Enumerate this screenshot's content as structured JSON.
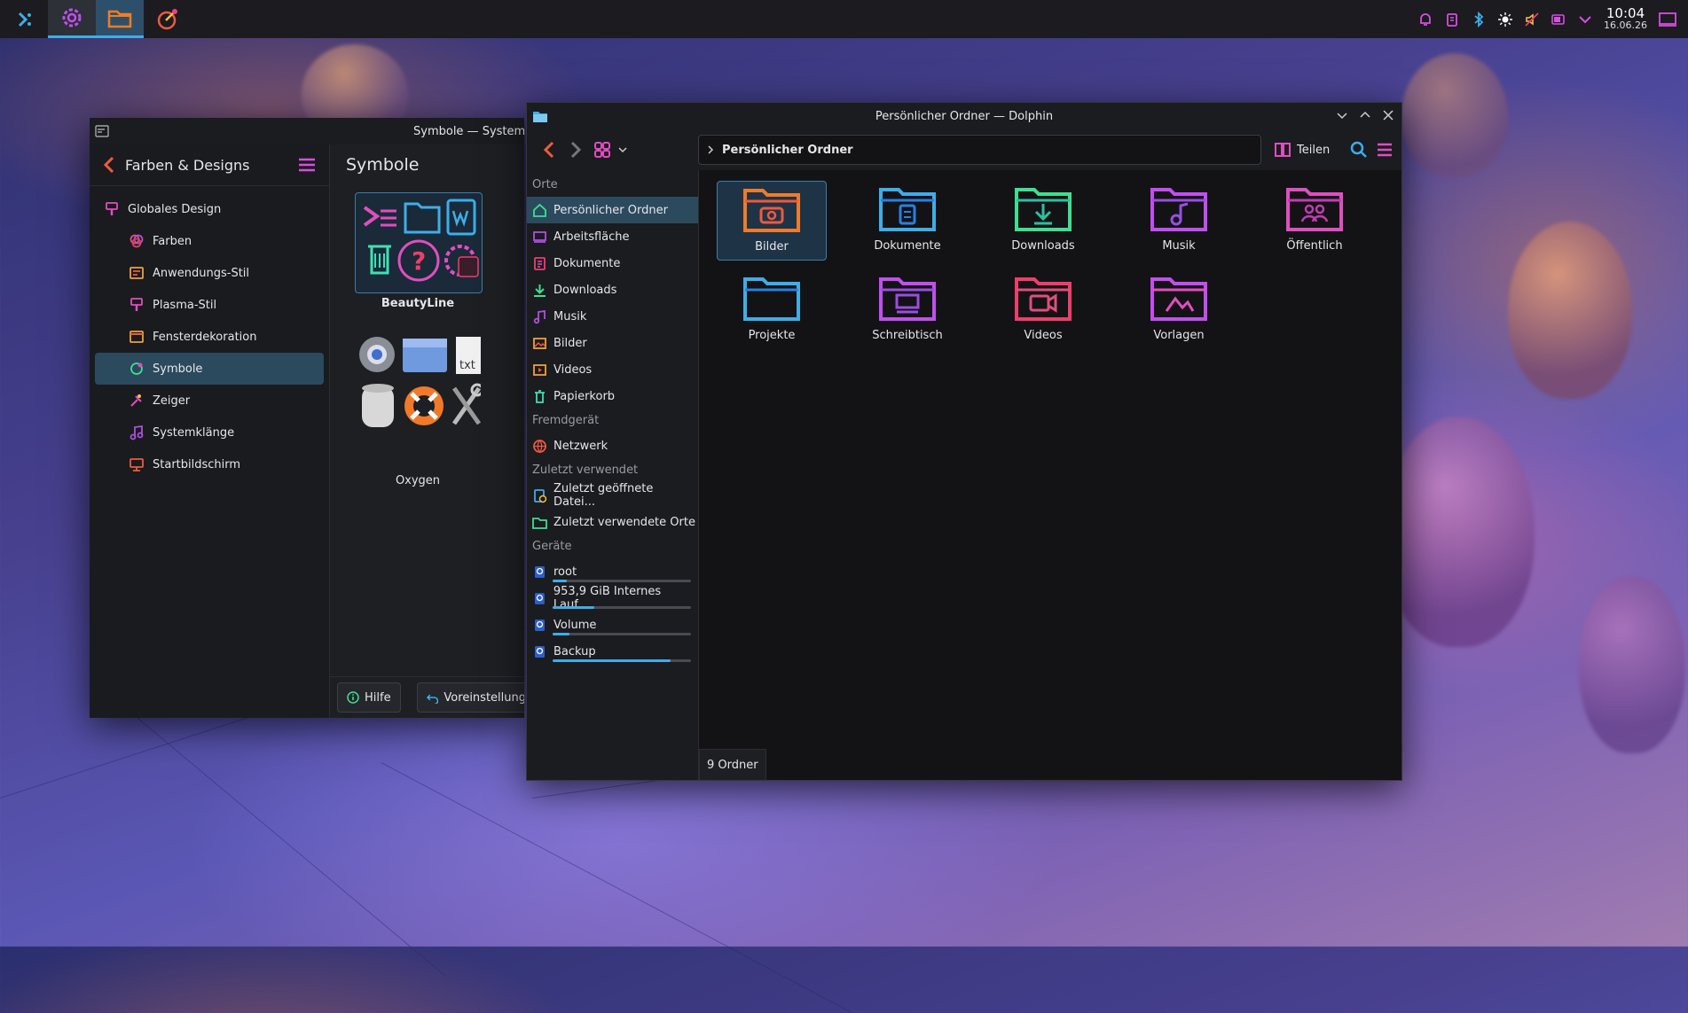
{
  "panel": {
    "clock_time": "10:04",
    "clock_date": "16.06.26"
  },
  "settings": {
    "title": "Symbole — Systemei",
    "back_label": "Farben & Designs",
    "page_title": "Symbole",
    "items": [
      {
        "label": "Globales Design"
      },
      {
        "label": "Farben"
      },
      {
        "label": "Anwendungs-Stil"
      },
      {
        "label": "Plasma-Stil"
      },
      {
        "label": "Fensterdekoration"
      },
      {
        "label": "Symbole"
      },
      {
        "label": "Zeiger"
      },
      {
        "label": "Systemklänge"
      },
      {
        "label": "Startbildschirm"
      }
    ],
    "themes": [
      {
        "name": "BeautyLine"
      },
      {
        "name": "Oxygen"
      }
    ],
    "help_button": "Hilfe",
    "defaults_button": "Voreinstellunge"
  },
  "dolphin": {
    "title": "Persönlicher Ordner — Dolphin",
    "location": "Persönlicher Ordner",
    "share_label": "Teilen",
    "sections": {
      "places": "Orte",
      "remote": "Fremdgerät",
      "recent": "Zuletzt verwendet",
      "devices": "Geräte"
    },
    "places": [
      {
        "label": "Persönlicher Ordner"
      },
      {
        "label": "Arbeitsfläche"
      },
      {
        "label": "Dokumente"
      },
      {
        "label": "Downloads"
      },
      {
        "label": "Musik"
      },
      {
        "label": "Bilder"
      },
      {
        "label": "Videos"
      },
      {
        "label": "Papierkorb"
      }
    ],
    "remote": [
      {
        "label": "Netzwerk"
      }
    ],
    "recent": [
      {
        "label": "Zuletzt geöffnete Datei..."
      },
      {
        "label": "Zuletzt verwendete Orte"
      }
    ],
    "devices": [
      {
        "label": "root",
        "usage": 0.1
      },
      {
        "label": "953,9 GiB Internes Lauf...",
        "usage": 0.3
      },
      {
        "label": "Volume",
        "usage": 0.12
      },
      {
        "label": "Backup",
        "usage": 0.85
      }
    ],
    "folders": [
      {
        "label": "Bilder"
      },
      {
        "label": "Dokumente"
      },
      {
        "label": "Downloads"
      },
      {
        "label": "Musik"
      },
      {
        "label": "Öffentlich"
      },
      {
        "label": "Projekte"
      },
      {
        "label": "Schreibtisch"
      },
      {
        "label": "Videos"
      },
      {
        "label": "Vorlagen"
      }
    ],
    "status": "9 Ordner"
  }
}
